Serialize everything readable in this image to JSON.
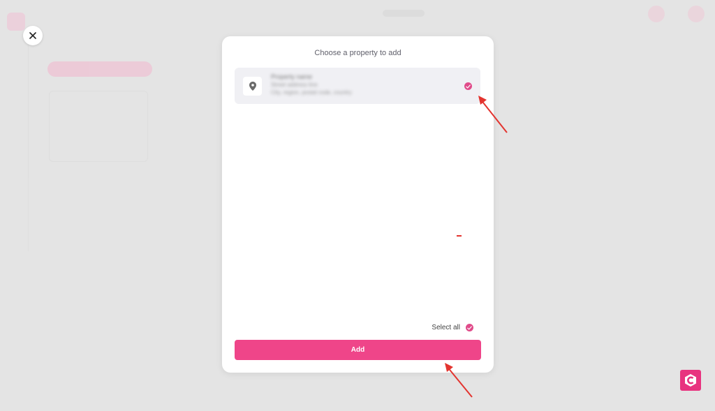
{
  "modal": {
    "title": "Choose a property to add",
    "select_all_label": "Select all",
    "add_button_label": "Add"
  },
  "property": {
    "name": "Property name",
    "address_line_1": "Street address line",
    "address_line_2": "City, region, postal code, country",
    "selected": true
  },
  "icons": {
    "close": "close-icon",
    "pin": "location-pin-icon",
    "check": "check-circle-icon",
    "brand": "brand-logo"
  },
  "colors": {
    "accent": "#ef4589",
    "check": "#e04b8a",
    "annotation": "#e3342f",
    "item_bg": "#f0f0f4",
    "backdrop": "#e4e4e4"
  }
}
